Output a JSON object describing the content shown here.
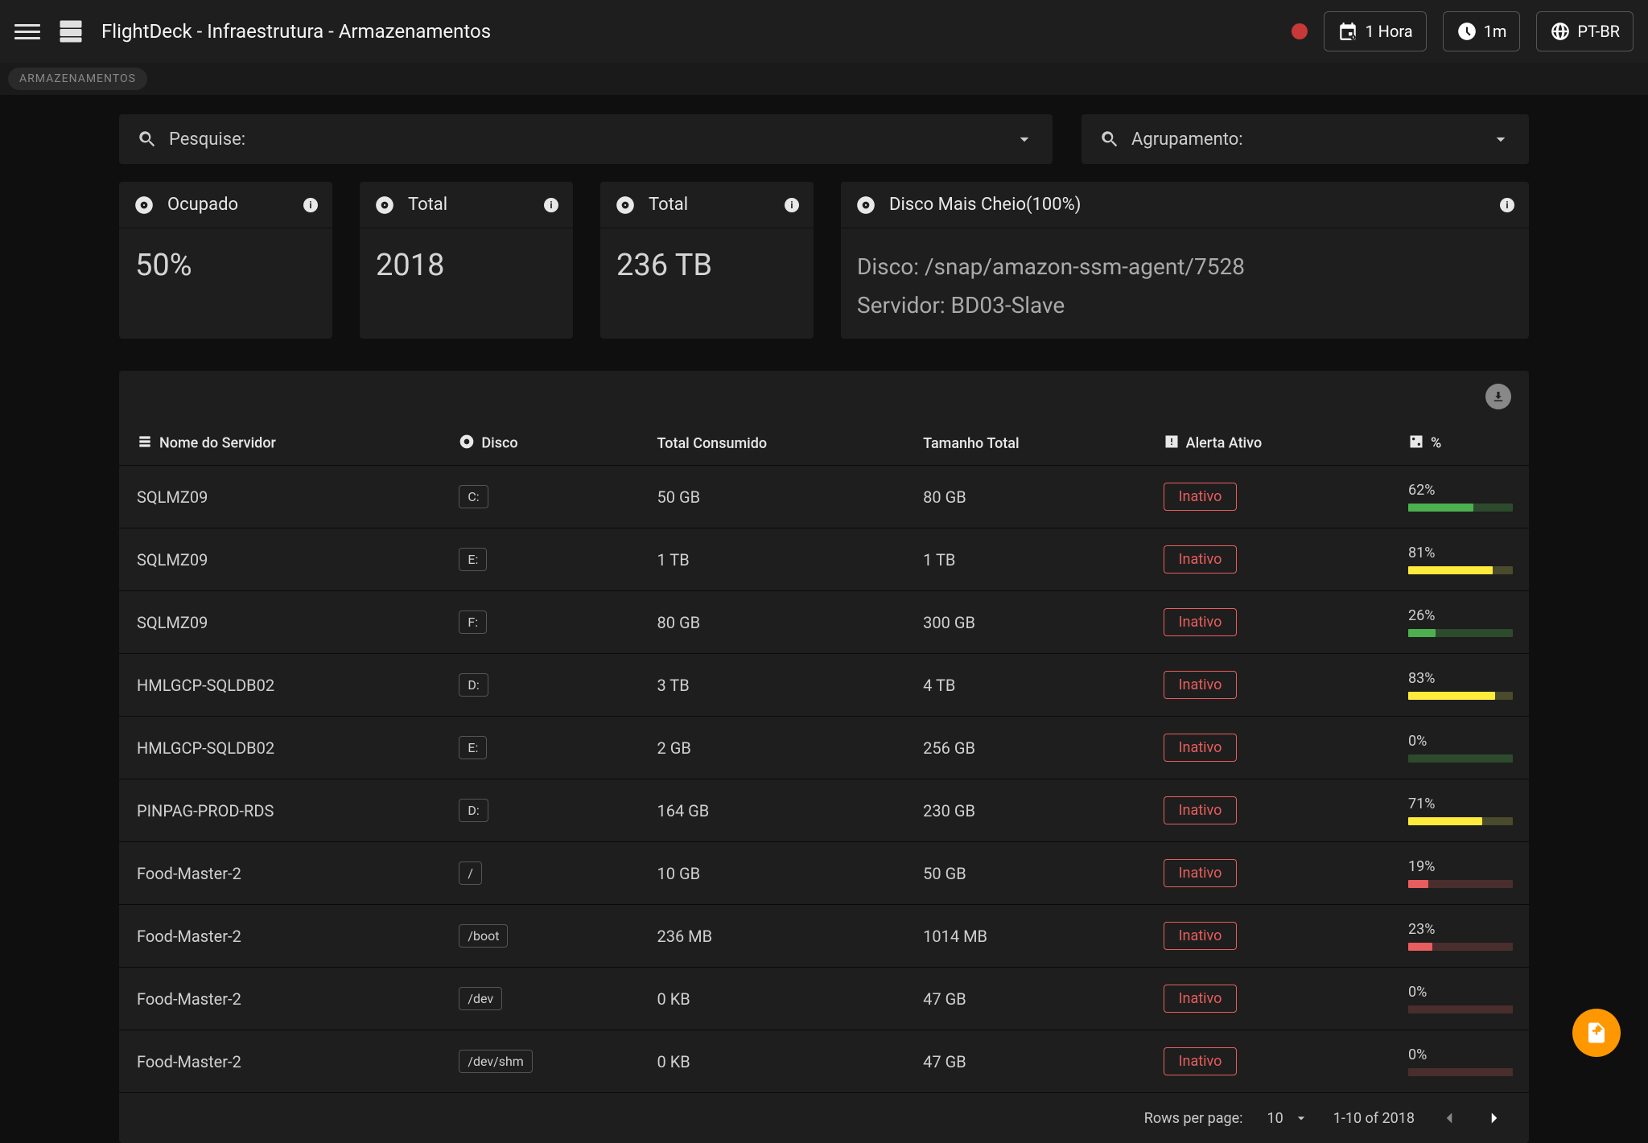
{
  "header": {
    "title": "FlightDeck - Infraestrutura - Armazenamentos",
    "time_range": "1 Hora",
    "refresh": "1m",
    "locale": "PT-BR"
  },
  "breadcrumb": "Armazenamentos",
  "search": {
    "label": "Pesquise:"
  },
  "grouping": {
    "label": "Agrupamento:"
  },
  "cards": {
    "ocupado": {
      "title": "Ocupado",
      "value": "50%"
    },
    "total_count": {
      "title": "Total",
      "value": "2018"
    },
    "total_size": {
      "title": "Total",
      "value": "236 TB"
    },
    "fullest": {
      "title": "Disco Mais Cheio(100%)",
      "line1": "Disco: /snap/amazon-ssm-agent/7528",
      "line2": "Servidor: BD03-Slave"
    }
  },
  "table": {
    "headers": {
      "server": "Nome do Servidor",
      "disk": "Disco",
      "consumed": "Total Consumido",
      "total": "Tamanho Total",
      "alert": "Alerta Ativo",
      "pct": "%"
    },
    "rows": [
      {
        "server": "SQLMZ09",
        "disk": "C:",
        "consumed": "50 GB",
        "total": "80 GB",
        "alert": "Inativo",
        "pct": 62,
        "color": "green"
      },
      {
        "server": "SQLMZ09",
        "disk": "E:",
        "consumed": "1 TB",
        "total": "1 TB",
        "alert": "Inativo",
        "pct": 81,
        "color": "yellow"
      },
      {
        "server": "SQLMZ09",
        "disk": "F:",
        "consumed": "80 GB",
        "total": "300 GB",
        "alert": "Inativo",
        "pct": 26,
        "color": "green"
      },
      {
        "server": "HMLGCP-SQLDB02",
        "disk": "D:",
        "consumed": "3 TB",
        "total": "4 TB",
        "alert": "Inativo",
        "pct": 83,
        "color": "yellow"
      },
      {
        "server": "HMLGCP-SQLDB02",
        "disk": "E:",
        "consumed": "2 GB",
        "total": "256 GB",
        "alert": "Inativo",
        "pct": 0,
        "color": "green"
      },
      {
        "server": "PINPAG-PROD-RDS",
        "disk": "D:",
        "consumed": "164 GB",
        "total": "230 GB",
        "alert": "Inativo",
        "pct": 71,
        "color": "yellow"
      },
      {
        "server": "Food-Master-2",
        "disk": "/",
        "consumed": "10 GB",
        "total": "50 GB",
        "alert": "Inativo",
        "pct": 19,
        "color": "red"
      },
      {
        "server": "Food-Master-2",
        "disk": "/boot",
        "consumed": "236 MB",
        "total": "1014 MB",
        "alert": "Inativo",
        "pct": 23,
        "color": "red"
      },
      {
        "server": "Food-Master-2",
        "disk": "/dev",
        "consumed": "0 KB",
        "total": "47 GB",
        "alert": "Inativo",
        "pct": 0,
        "color": "red"
      },
      {
        "server": "Food-Master-2",
        "disk": "/dev/shm",
        "consumed": "0 KB",
        "total": "47 GB",
        "alert": "Inativo",
        "pct": 0,
        "color": "red"
      }
    ]
  },
  "pagination": {
    "rows_label": "Rows per page:",
    "rows_value": "10",
    "range": "1-10 of 2018"
  }
}
